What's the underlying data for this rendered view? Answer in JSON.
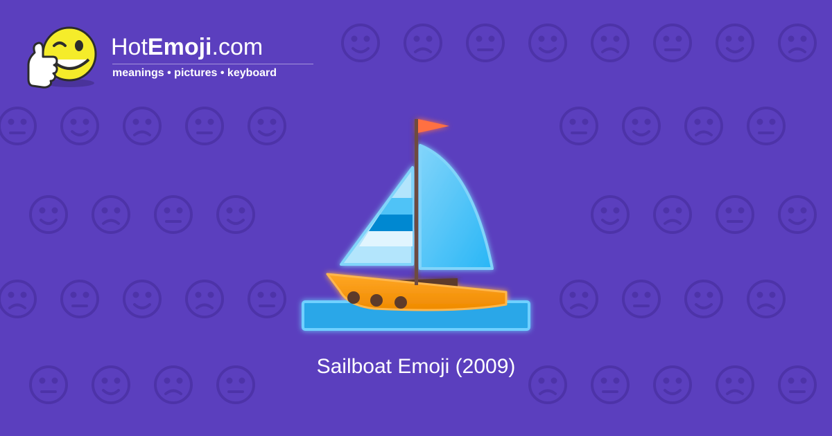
{
  "brand": {
    "name_prefix": "Hot",
    "name_bold": "Emoji",
    "name_suffix": ".com",
    "tagline": "meanings • pictures • keyboard"
  },
  "emoji": {
    "caption": "Sailboat Emoji (2009)",
    "icon": "sailboat-icon"
  },
  "colors": {
    "background": "#5b3fbe",
    "pattern": "#4d33a8",
    "text": "#ffffff",
    "sail": "#4fc3f7",
    "hull": "#fb8c00",
    "flag": "#ff7043",
    "water": "#29b6f6"
  }
}
